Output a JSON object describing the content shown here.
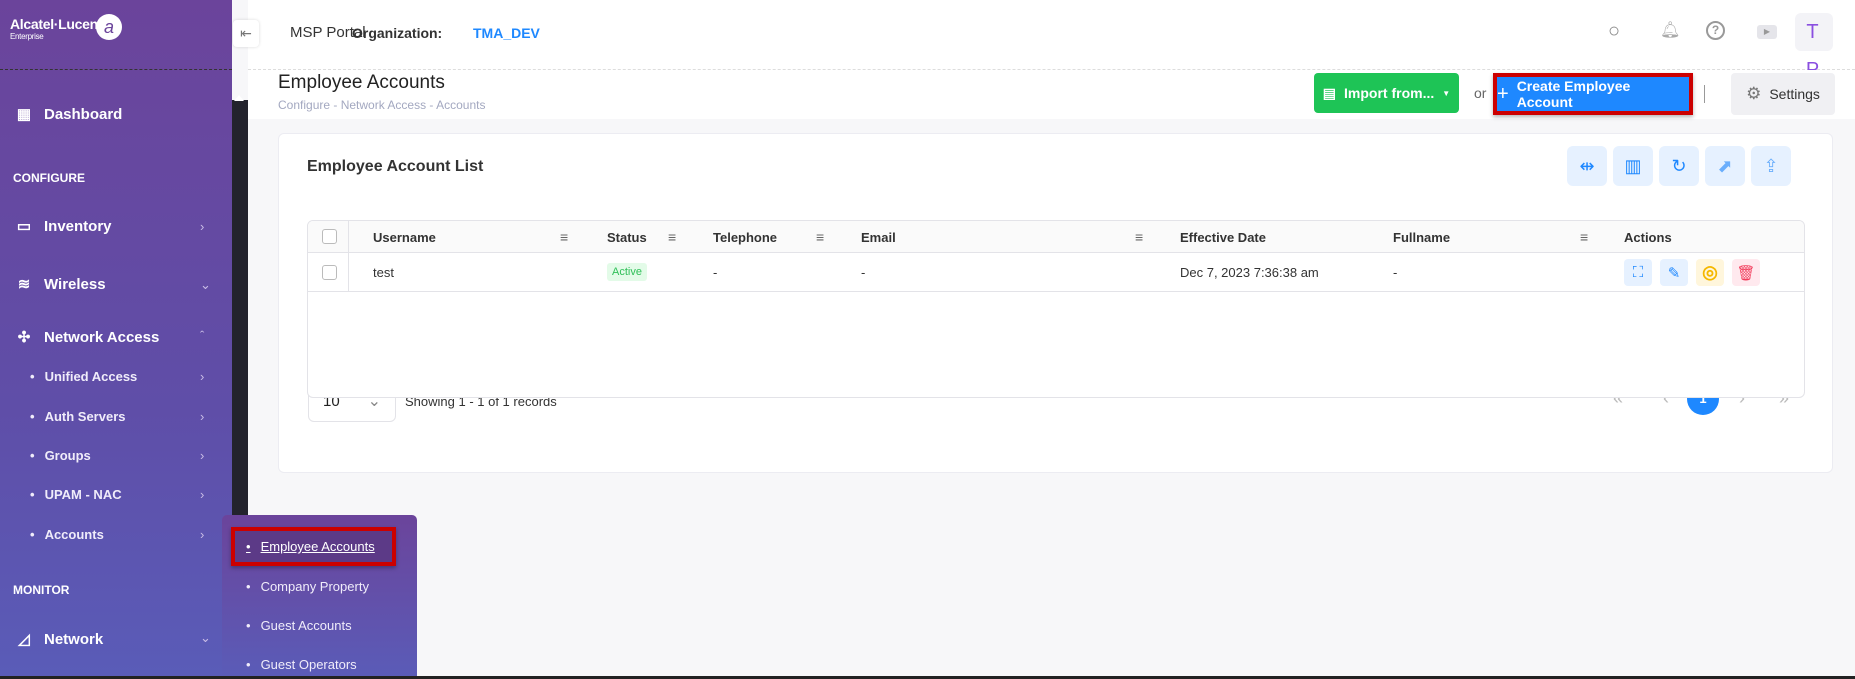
{
  "brand": {
    "name": "Alcatel·Lucent",
    "sub": "Enterprise"
  },
  "header": {
    "portal": "MSP Portal",
    "org_label": "Organization:",
    "org_value": "TMA_DEV",
    "avatar": "T P"
  },
  "sidebar": {
    "dashboard": "Dashboard",
    "configure": "CONFIGURE",
    "inventory": "Inventory",
    "wireless": "Wireless",
    "network_access": "Network Access",
    "sub_items": [
      "Unified Access",
      "Auth Servers",
      "Groups",
      "UPAM - NAC",
      "Accounts"
    ],
    "monitor": "MONITOR",
    "network": "Network"
  },
  "submenu": {
    "items": [
      "Employee Accounts",
      "Company Property",
      "Guest Accounts",
      "Guest Operators"
    ],
    "active": "Employee Accounts"
  },
  "page": {
    "title": "Employee Accounts",
    "breadcrumb": [
      "Configure",
      "Network Access",
      "Accounts"
    ],
    "breadcrumb_sep": "-"
  },
  "actions": {
    "import": "Import from...",
    "or": "or",
    "create": "Create Employee Account",
    "settings": "Settings"
  },
  "card": {
    "title": "Employee Account List"
  },
  "table": {
    "columns": [
      "Username",
      "Status",
      "Telephone",
      "Email",
      "Effective Date",
      "Fullname",
      "Actions"
    ],
    "rows": [
      {
        "username": "test",
        "status": "Active",
        "telephone": "-",
        "email": "-",
        "effective_date": "Dec 7, 2023 7:36:38 am",
        "fullname": "-"
      }
    ]
  },
  "pagination": {
    "page_size": "10",
    "summary": "Showing 1 - 1 of 1 records",
    "current_page": "1"
  },
  "colors": {
    "sidebar": "#6b449b",
    "primary": "#1e88ff",
    "success": "#1ec456",
    "highlight": "#cc0000"
  }
}
